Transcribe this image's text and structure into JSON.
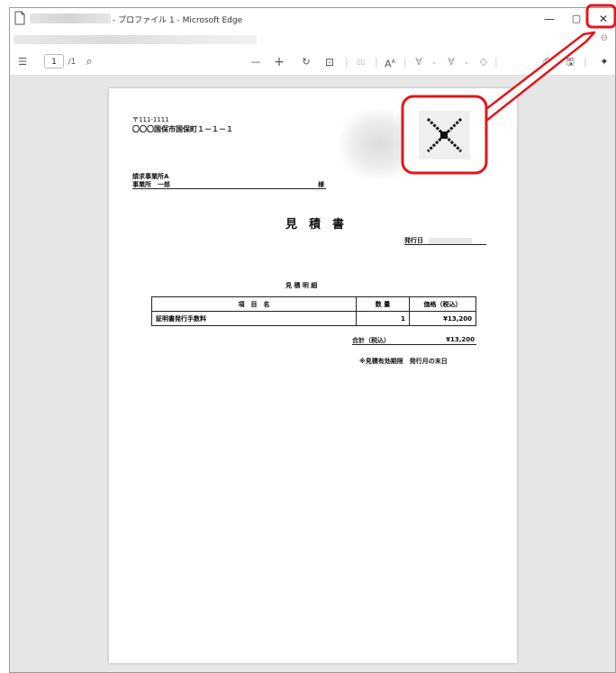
{
  "window": {
    "title": "- プロファイル 1 - Microsoft Edge",
    "min_glyph": "—",
    "max_glyph": "▢",
    "close_glyph": "✕"
  },
  "toolbar": {
    "contents_glyph": "☰",
    "page_current": "1",
    "page_total": "/1",
    "search_glyph": "⌕",
    "zoom_out": "—",
    "zoom_in": "+",
    "rotate_glyph": "↻",
    "fit_glyph": "⊡",
    "two_page_glyph": "▯▯",
    "read_aloud": "A",
    "draw_glyph": "∀",
    "highlight_glyph": "∀",
    "erase_glyph": "◇",
    "print_glyph": "⎙",
    "save_glyph": "🖫",
    "pin_glyph": "✦"
  },
  "document": {
    "postal": "〒111-1111",
    "address": "〇〇〇国保市国保町１－１－１",
    "recipient_company": "請求事業所A",
    "recipient_dept": "事業所　一郎",
    "honorific": "様",
    "heading": "見　積　書",
    "issue_label": "発行日",
    "detail_heading": "見 積 明 細",
    "table": {
      "headers": [
        "項　目　名",
        "数 量",
        "価格（税込）"
      ],
      "rows": [
        [
          "証明書発行手数料",
          "1",
          "¥13,200"
        ]
      ]
    },
    "total_label": "合計（税込）",
    "total_value": "¥13,200",
    "validity_note": "※見積有効期限　発行月の末日"
  },
  "highlight": {
    "color": "#e3151a",
    "zoomed_icon": "close-icon"
  }
}
